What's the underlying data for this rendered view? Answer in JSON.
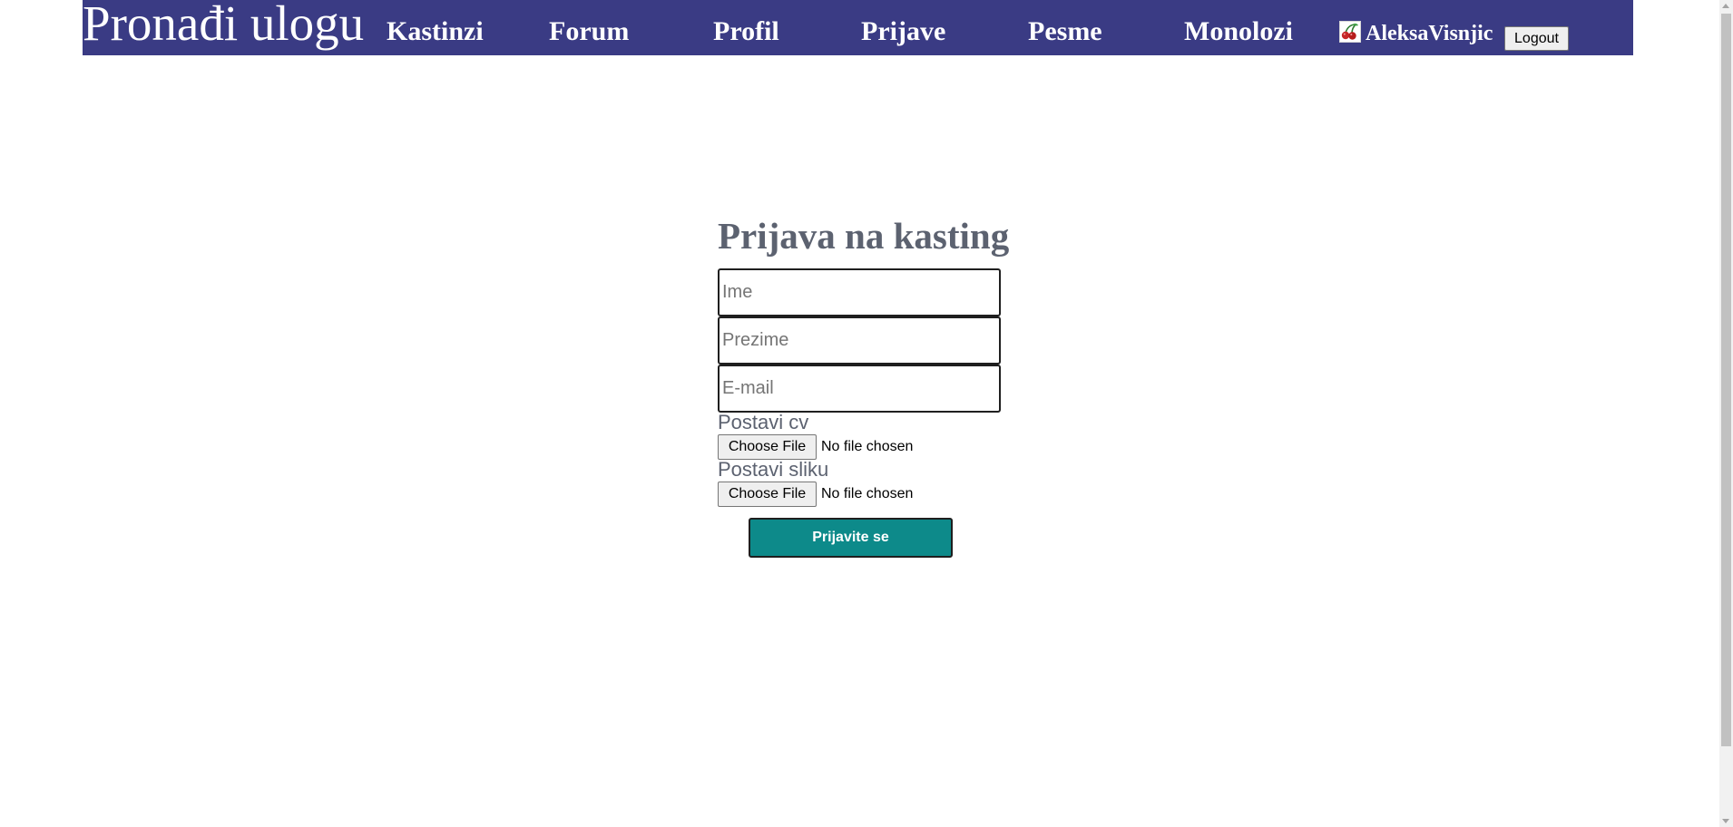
{
  "navbar": {
    "brand": "Pronađi ulogu",
    "links": [
      "Kastinzi",
      "Forum",
      "Profil",
      "Prijave",
      "Pesme",
      "Monolozi"
    ],
    "username": "AleksaVisnjic",
    "avatar_icon": "cherries-icon",
    "logout_label": "Logout",
    "background_color": "#3a3b84"
  },
  "form": {
    "title": "Prijava na kasting",
    "fields": {
      "first_name_placeholder": "Ime",
      "last_name_placeholder": "Prezime",
      "email_placeholder": "E-mail"
    },
    "uploads": {
      "cv_label": "Postavi cv",
      "photo_label": "Postavi sliku",
      "choose_label": "Choose File",
      "status": "No file chosen"
    },
    "submit_label": "Prijavite se",
    "submit_color": "#0d8a8a",
    "title_color": "#5c6270"
  }
}
